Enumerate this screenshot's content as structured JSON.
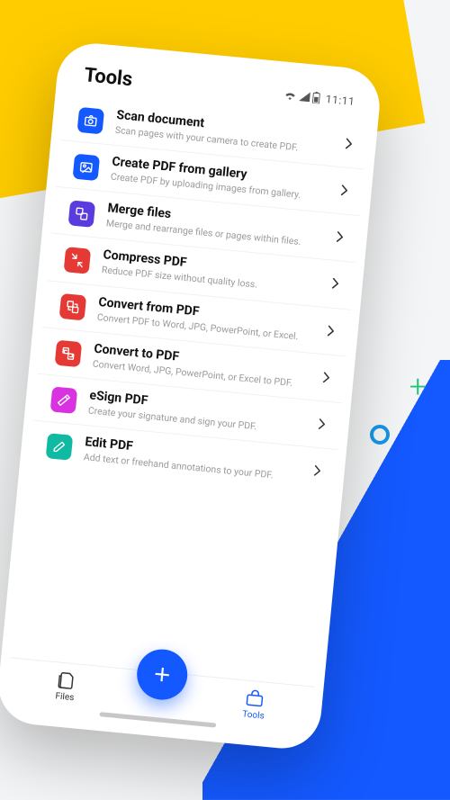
{
  "statusbar": {
    "title": "Tools",
    "time": "11:11"
  },
  "tools": [
    {
      "title": "Scan document",
      "sub": "Scan pages with your camera to create PDF.",
      "icon": "camera-icon",
      "color": "#1459ff"
    },
    {
      "title": "Create PDF from gallery",
      "sub": "Create PDF by uploading images from gallery.",
      "icon": "gallery-icon",
      "color": "#1459ff"
    },
    {
      "title": "Merge files",
      "sub": "Merge and rearrange files or pages within files.",
      "icon": "merge-icon",
      "color": "#5a3be0"
    },
    {
      "title": "Compress PDF",
      "sub": "Reduce PDF size without quality loss.",
      "icon": "compress-icon",
      "color": "#e53935"
    },
    {
      "title": "Convert from PDF",
      "sub": "Convert PDF to Word, JPG, PowerPoint, or Excel.",
      "icon": "convert-from-icon",
      "color": "#e53935"
    },
    {
      "title": "Convert to PDF",
      "sub": "Convert Word, JPG, PowerPoint, or Excel to PDF.",
      "icon": "convert-to-icon",
      "color": "#e53935"
    },
    {
      "title": "eSign PDF",
      "sub": "Create your signature and sign your PDF.",
      "icon": "sign-icon",
      "color": "#d932e0"
    },
    {
      "title": "Edit PDF",
      "sub": "Add text or freehand annotations to your PDF.",
      "icon": "edit-icon",
      "color": "#10b9a2"
    }
  ],
  "bottombar": {
    "files": "Files",
    "tools": "Tools"
  }
}
